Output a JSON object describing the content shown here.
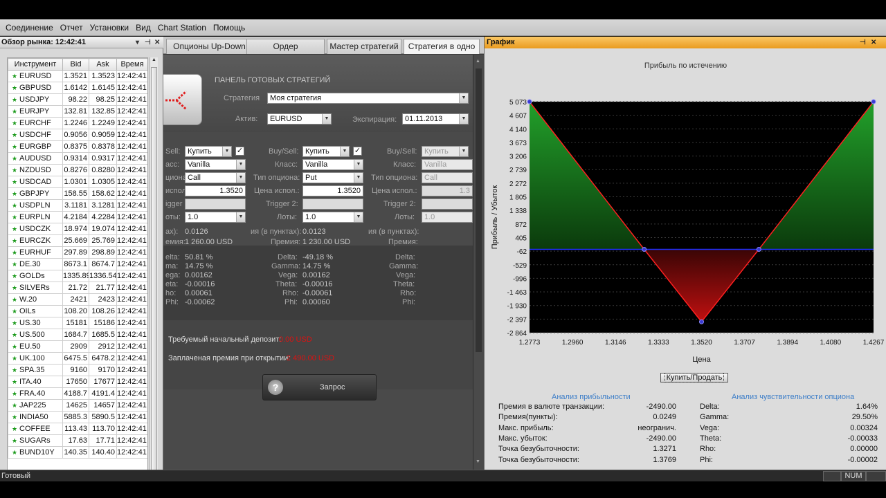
{
  "menu": [
    "Соединение",
    "Отчет",
    "Установки",
    "Вид",
    "Chart Station",
    "Помощь"
  ],
  "market": {
    "title": "Обзор рынка: 12:42:41",
    "columns": [
      "Инструмент",
      "Bid",
      "Ask",
      "Время"
    ],
    "rows": [
      [
        "EURUSD",
        "1.3521",
        "1.3523",
        "12:42:41"
      ],
      [
        "GBPUSD",
        "1.6142",
        "1.6145",
        "12:42:41"
      ],
      [
        "USDJPY",
        "98.22",
        "98.25",
        "12:42:41"
      ],
      [
        "EURJPY",
        "132.81",
        "132.85",
        "12:42:41"
      ],
      [
        "EURCHF",
        "1.2246",
        "1.2249",
        "12:42:41"
      ],
      [
        "USDCHF",
        "0.9056",
        "0.9059",
        "12:42:41"
      ],
      [
        "EURGBP",
        "0.8375",
        "0.8378",
        "12:42:41"
      ],
      [
        "AUDUSD",
        "0.9314",
        "0.9317",
        "12:42:41"
      ],
      [
        "NZDUSD",
        "0.8276",
        "0.8280",
        "12:42:41"
      ],
      [
        "USDCAD",
        "1.0301",
        "1.0305",
        "12:42:41"
      ],
      [
        "GBPJPY",
        "158.55",
        "158.62",
        "12:42:41"
      ],
      [
        "USDPLN",
        "3.1181",
        "3.1281",
        "12:42:41"
      ],
      [
        "EURPLN",
        "4.2184",
        "4.2284",
        "12:42:41"
      ],
      [
        "USDCZK",
        "18.974",
        "19.074",
        "12:42:41"
      ],
      [
        "EURCZK",
        "25.669",
        "25.769",
        "12:42:41"
      ],
      [
        "EURHUF",
        "297.89",
        "298.89",
        "12:42:41"
      ],
      [
        "DE.30",
        "8673.1",
        "8674.7",
        "12:42:41"
      ],
      [
        "GOLDs",
        "1335.89",
        "1336.54",
        "12:42:41"
      ],
      [
        "SILVERs",
        "21.72",
        "21.77",
        "12:42:41"
      ],
      [
        "W.20",
        "2421",
        "2423",
        "12:42:41"
      ],
      [
        "OILs",
        "108.20",
        "108.26",
        "12:42:41"
      ],
      [
        "US.30",
        "15181",
        "15186",
        "12:42:41"
      ],
      [
        "US.500",
        "1684.7",
        "1685.5",
        "12:42:41"
      ],
      [
        "EU.50",
        "2909",
        "2912",
        "12:42:41"
      ],
      [
        "UK.100",
        "6475.5",
        "6478.2",
        "12:42:41"
      ],
      [
        "SPA.35",
        "9160",
        "9170",
        "12:42:41"
      ],
      [
        "ITA.40",
        "17650",
        "17677",
        "12:42:41"
      ],
      [
        "FRA.40",
        "4188.7",
        "4191.4",
        "12:42:41"
      ],
      [
        "JAP225",
        "14625",
        "14657",
        "12:42:41"
      ],
      [
        "INDIA50",
        "5885.3",
        "5890.5",
        "12:42:41"
      ],
      [
        "COFFEE",
        "113.43",
        "113.70",
        "12:42:41"
      ],
      [
        "SUGARs",
        "17.63",
        "17.71",
        "12:42:41"
      ],
      [
        "BUND10Y",
        "140.35",
        "140.40",
        "12:42:41"
      ]
    ]
  },
  "tabs": [
    "Опционы Up-Down",
    "Ордер",
    "Мастер стратегий",
    "Стратегия в одно ..."
  ],
  "strategy": {
    "panel_title": "ПАНЕЛЬ ГОТОВЫХ СТРАТЕГИЙ",
    "strategy_label": "Стратегия",
    "strategy_value": "Моя стратегия",
    "asset_label": "Актив:",
    "asset_value": "EURUSD",
    "expiry_label": "Экспирация:",
    "expiry_value": "01.11.2013",
    "col1": {
      "buysell_label": "Sell:",
      "buysell": "Купить",
      "checked": "✓",
      "class_label": "асс:",
      "class": "Vanilla",
      "type_label": "циона:",
      "type": "Call",
      "strike_label": "испол.:",
      "strike": "1.3520",
      "trigger_label": "igger 2:",
      "lots_label": "оты:",
      "lots": "1.0",
      "max_label": "ax):",
      "max_val": "0.0126",
      "prem_label": "емия:",
      "prem_val": "1 260.00 USD",
      "delta_l": "elta:",
      "delta": "50.81 %",
      "gamma_l": "ma:",
      "gamma": "14.75 %",
      "vega_l": "ega:",
      "vega": "0.00162",
      "theta_l": "eta:",
      "theta": "-0.00016",
      "rho_l": "ho:",
      "rho": "0.00061",
      "phi_l": "Phi:",
      "phi": "-0.00062"
    },
    "col2": {
      "buysell_label": "Buy/Sell:",
      "buysell": "Купить",
      "checked": "✓",
      "class_label": "Класс:",
      "class": "Vanilla",
      "type_label": "Тип опциона:",
      "type": "Put",
      "strike_label": "Цена испол.:",
      "strike": "1.3520",
      "trigger_label": "Trigger 2:",
      "lots_label": "Лоты:",
      "lots": "1.0",
      "max_label": "ия (в пунктах):",
      "max_val": "0.0123",
      "prem_label": "Премия:",
      "prem_val": "1 230.00 USD",
      "delta_l": "Delta:",
      "delta": "-49.18 %",
      "gamma_l": "Gamma:",
      "gamma": "14.75 %",
      "vega_l": "Vega:",
      "vega": "0.00162",
      "theta_l": "Theta:",
      "theta": "-0.00016",
      "rho_l": "Rho:",
      "rho": "-0.00061",
      "phi_l": "Phi:",
      "phi": "0.00060"
    },
    "col3": {
      "buysell_label": "Buy/Sell:",
      "buysell": "Купить",
      "class_label": "Класс:",
      "class": "Vanilla",
      "type_label": "Тип опциона:",
      "type": "Call",
      "strike_label": "Цена испол.:",
      "strike": "1.3",
      "trigger_label": "Trigger 2:",
      "lots_label": "Лоты:",
      "lots": "1.0",
      "max_label": "ия (в пунктах):",
      "prem_label": "Премия:",
      "delta_l": "Delta:",
      "gamma_l": "Gamma:",
      "vega_l": "Vega:",
      "theta_l": "Theta:",
      "rho_l": "Rho:",
      "phi_l": "Phi:"
    },
    "deposit_label": "Требуемый начальный депозит:",
    "deposit_value": "0.00 USD",
    "premium_label": "Заплаченая премия  при открытии:",
    "premium_value": "2 490.00 USD",
    "request_label": "Запрос",
    "request_icon": "?"
  },
  "chart": {
    "window_title": "График",
    "subtitle": "Прибыль по истечению",
    "buy_sell_label": "Купить/Продать",
    "colors": {
      "profit": "#22a02a",
      "loss": "#c01010",
      "line": "#ff2020",
      "zero": "#2030ff"
    },
    "analysis_title": "Анализ прибыльности",
    "sensitivity_title": "Анализ чувствительности опциона",
    "analysis": [
      [
        "Премия в валюте транзакции:",
        "-2490.00"
      ],
      [
        "Премия(пункты):",
        "0.0249"
      ],
      [
        "Макс. прибыль:",
        "неогранич."
      ],
      [
        "Макс. убыток:",
        "-2490.00"
      ],
      [
        "Точка безубыточности:",
        "1.3271"
      ],
      [
        "Точка безубыточности:",
        "1.3769"
      ]
    ],
    "sensitivity": [
      [
        "Delta:",
        "1.64%"
      ],
      [
        "Gamma:",
        "29.50%"
      ],
      [
        "Vega:",
        "0.00324"
      ],
      [
        "Theta:",
        "-0.00033"
      ],
      [
        "Rho:",
        "0.00000"
      ],
      [
        "Phi:",
        "-0.00002"
      ]
    ]
  },
  "chart_data": {
    "type": "line",
    "title": "Прибыль по истечению",
    "xlabel": "Цена",
    "ylabel": "Прибыль / Убыток",
    "x_ticks": [
      "1.2773",
      "1.2960",
      "1.3146",
      "1.3333",
      "1.3520",
      "1.3707",
      "1.3894",
      "1.4080",
      "1.4267"
    ],
    "y_ticks": [
      "5 073",
      "4 607",
      "4 140",
      "3 673",
      "3 206",
      "2 739",
      "2 272",
      "1 805",
      "1 338",
      "872",
      "405",
      "-62",
      "-529",
      "-996",
      "-1 463",
      "-1 930",
      "-2 397",
      "-2 864"
    ],
    "xlim": [
      1.2773,
      1.4267
    ],
    "ylim": [
      -2864,
      5073
    ],
    "grid": true,
    "series": [
      {
        "x": [
          1.2773,
          1.3271,
          1.352,
          1.3769,
          1.4267
        ],
        "y": [
          5073,
          0,
          -2490,
          0,
          5073
        ]
      }
    ]
  },
  "status": {
    "text": "Готовый",
    "num": "NUM"
  }
}
